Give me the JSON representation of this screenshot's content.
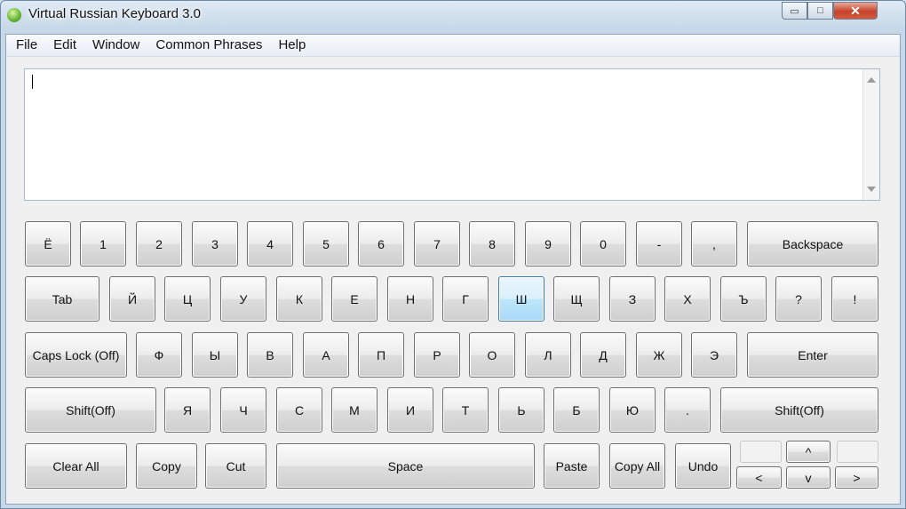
{
  "window": {
    "title": "Virtual Russian Keyboard 3.0",
    "controls": {
      "minimize": "▭",
      "maximize": "□",
      "close": "✕"
    }
  },
  "menu": [
    "File",
    "Edit",
    "Window",
    "Common Phrases",
    "Help"
  ],
  "text_area": {
    "value": ""
  },
  "keys": {
    "row1": [
      "Ё",
      "1",
      "2",
      "3",
      "4",
      "5",
      "6",
      "7",
      "8",
      "9",
      "0",
      "-",
      ",",
      "Backspace"
    ],
    "row2": [
      "Tab",
      "Й",
      "Ц",
      "У",
      "К",
      "Е",
      "Н",
      "Г",
      "Ш",
      "Щ",
      "З",
      "Х",
      "Ъ",
      "?",
      "!"
    ],
    "row3": [
      "Caps Lock (Off)",
      "Ф",
      "Ы",
      "В",
      "А",
      "П",
      "Р",
      "О",
      "Л",
      "Д",
      "Ж",
      "Э",
      "Enter"
    ],
    "row4": [
      "Shift(Off)",
      "Я",
      "Ч",
      "С",
      "М",
      "И",
      "Т",
      "Ь",
      "Б",
      "Ю",
      ".",
      "Shift(Off)"
    ],
    "row5": [
      "Clear All",
      "Copy",
      "Cut",
      "Space",
      "Paste",
      "Copy All",
      "Undo"
    ],
    "arrows": {
      "up": "^",
      "left": "<",
      "down": "v",
      "right": ">"
    }
  },
  "highlighted_key": "Ш"
}
